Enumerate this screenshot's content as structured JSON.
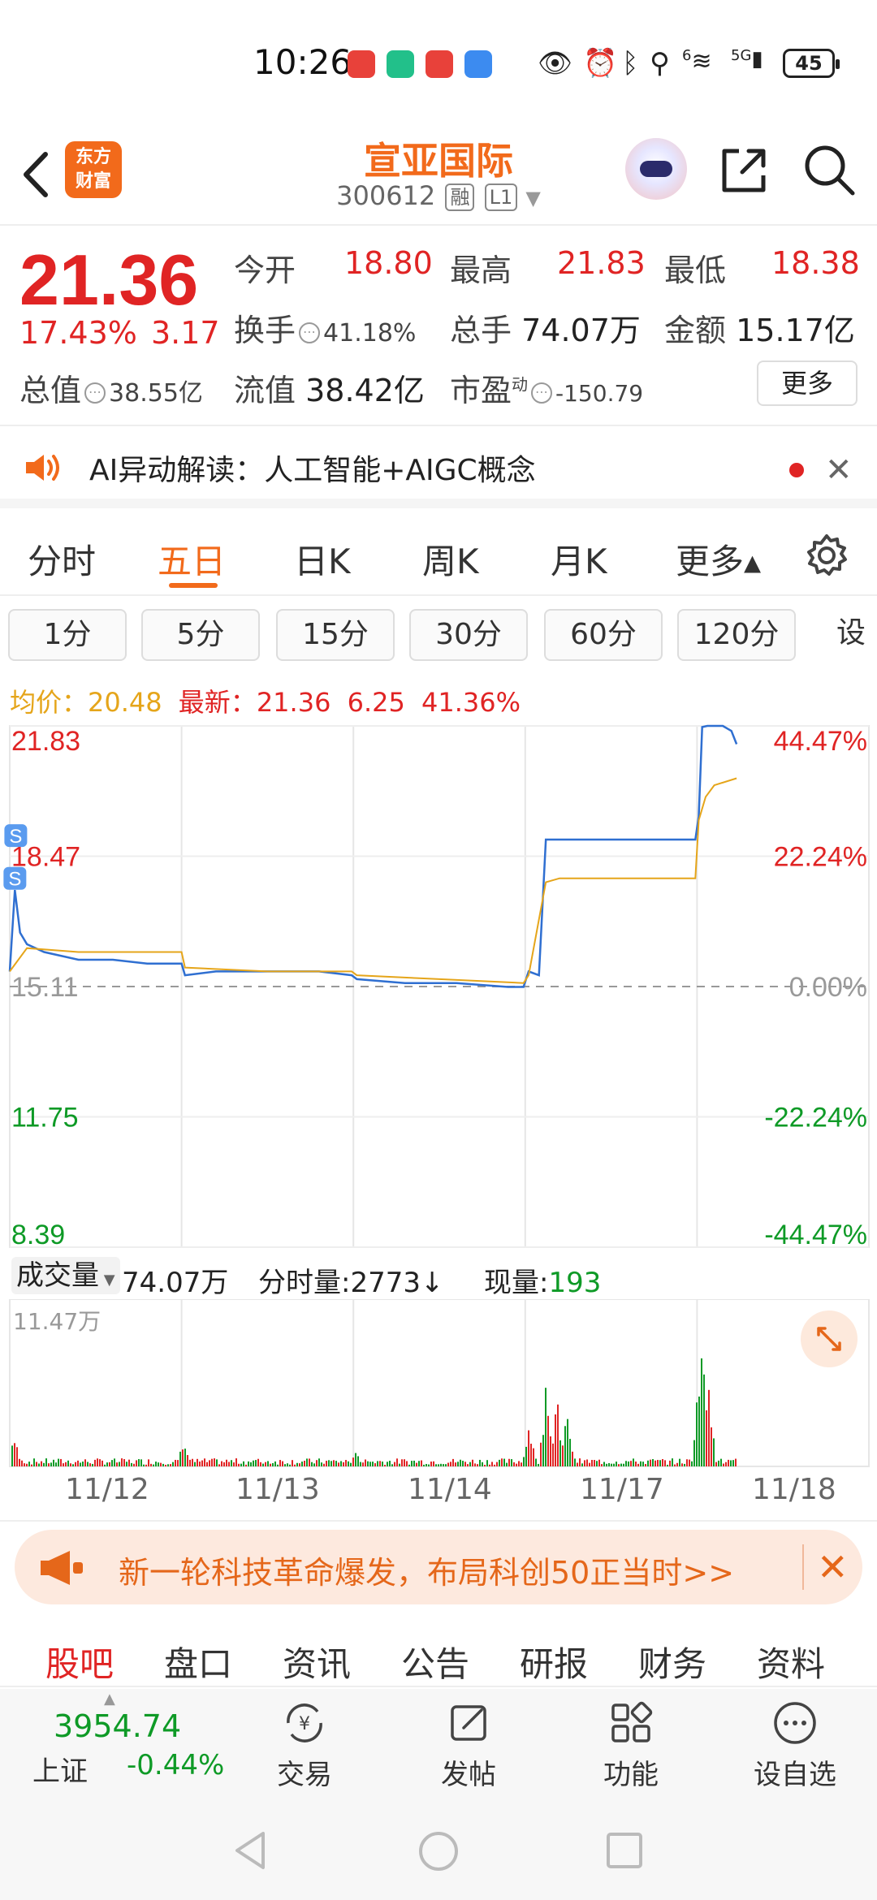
{
  "status_bar": {
    "time": "10:26",
    "battery": "45",
    "signal": "5G",
    "wifi_label": "6"
  },
  "header": {
    "brand_logo_line1": "东方",
    "brand_logo_line2": "财富",
    "stock_name": "宣亚国际",
    "stock_code": "300612",
    "tag_margin": "融",
    "tag_level": "L1"
  },
  "quote": {
    "price": "21.36",
    "change_pct": "17.43%",
    "change": "3.17",
    "open_label": "今开",
    "open": "18.80",
    "high_label": "最高",
    "high": "21.83",
    "low_label": "最低",
    "low": "18.38",
    "turnover_label": "换手",
    "turnover": "41.18%",
    "volume_label": "总手",
    "volume": "74.07万",
    "amount_label": "金额",
    "amount": "15.17亿",
    "mktcap_label": "总值",
    "mktcap": "38.55亿",
    "float_label": "流值",
    "float_cap": "38.42亿",
    "pe_label": "市盈",
    "pe_super": "动",
    "pe": "-150.79",
    "more_label": "更多"
  },
  "ai_banner": {
    "text": "AI异动解读：人工智能+AIGC概念"
  },
  "period_tabs": [
    "分时",
    "五日",
    "日K",
    "周K",
    "月K",
    "更多▴"
  ],
  "active_period": "五日",
  "minute_chips": [
    "1分",
    "5分",
    "15分",
    "30分",
    "60分",
    "120分",
    "设置"
  ],
  "avg_row": {
    "avg_label": "均价：",
    "avg": "20.48",
    "latest_label": "最新：",
    "latest": "21.36",
    "latest_chg": "6.25",
    "latest_pct": "41.36%"
  },
  "chart_data": {
    "type": "line",
    "title": "",
    "x_categories": [
      "11/12",
      "11/13",
      "11/14",
      "11/17",
      "11/18"
    ],
    "y_ticks": [
      "21.83",
      "18.47",
      "15.11",
      "11.75",
      "8.39"
    ],
    "y_pct_ticks": [
      "44.47%",
      "22.24%",
      "0.00%",
      "-22.24%",
      "-44.47%"
    ],
    "ylim": [
      8.39,
      21.83
    ],
    "prev_close": 15.11,
    "series": [
      {
        "name": "",
        "color": "#2f6fd1",
        "x": [
          0.0,
          0.03,
          0.06,
          0.1,
          0.2,
          0.4,
          0.6,
          0.8,
          1.0,
          1.02,
          1.2,
          1.5,
          1.8,
          1.99,
          2.02,
          2.3,
          2.6,
          2.9,
          2.99,
          3.02,
          3.08,
          3.12,
          3.18,
          3.3,
          3.6,
          3.99,
          4.01,
          4.03,
          4.06,
          4.1,
          4.15,
          4.2,
          4.23
        ],
        "y": [
          15.5,
          17.6,
          16.5,
          16.2,
          16.0,
          15.8,
          15.8,
          15.7,
          15.7,
          15.4,
          15.5,
          15.5,
          15.5,
          15.4,
          15.3,
          15.2,
          15.2,
          15.1,
          15.1,
          15.5,
          15.4,
          18.9,
          18.9,
          18.9,
          18.9,
          18.9,
          19.5,
          21.8,
          21.83,
          21.83,
          21.83,
          21.7,
          21.36
        ]
      },
      {
        "name": "均价",
        "color": "#e5a51a",
        "x": [
          0.0,
          0.1,
          0.4,
          0.8,
          1.0,
          1.02,
          1.5,
          1.99,
          2.02,
          2.5,
          2.99,
          3.02,
          3.12,
          3.2,
          3.5,
          3.99,
          4.01,
          4.05,
          4.1,
          4.23
        ],
        "y": [
          15.5,
          16.1,
          16.0,
          16.0,
          16.0,
          15.6,
          15.5,
          15.5,
          15.4,
          15.3,
          15.2,
          15.4,
          17.8,
          17.9,
          17.9,
          17.9,
          19.4,
          20.0,
          20.3,
          20.48
        ]
      }
    ]
  },
  "volume": {
    "label": "成交量",
    "total": "74.07万",
    "minute_label": "分时量:",
    "minute_value": "2773",
    "minute_arrow": "↓",
    "current_label": "现量:",
    "current_value": "193",
    "max_label": "11.47万"
  },
  "promo": {
    "text": "新一轮科技革命爆发，布局科创50正当时>>"
  },
  "info_tabs": [
    "股吧",
    "盘口",
    "资讯",
    "公告",
    "研报",
    "财务",
    "资料"
  ],
  "toolbar": {
    "index_value": "3954.74",
    "index_name": "上证",
    "index_pct": "-0.44%",
    "trade": "交易",
    "post": "发帖",
    "functions": "功能",
    "watchlist": "设自选"
  },
  "icons": [
    "back-icon",
    "share-icon",
    "search-icon",
    "speaker-icon",
    "close-icon",
    "gear-icon",
    "expand-icon",
    "megaphone-icon",
    "trade-icon",
    "edit-icon",
    "grid-icon",
    "more-dots-icon"
  ],
  "colors": {
    "up": "#e02424",
    "down": "#0e9a26",
    "accent": "#f26a1b",
    "avg": "#e5a51a",
    "price_line": "#2f6fd1"
  }
}
